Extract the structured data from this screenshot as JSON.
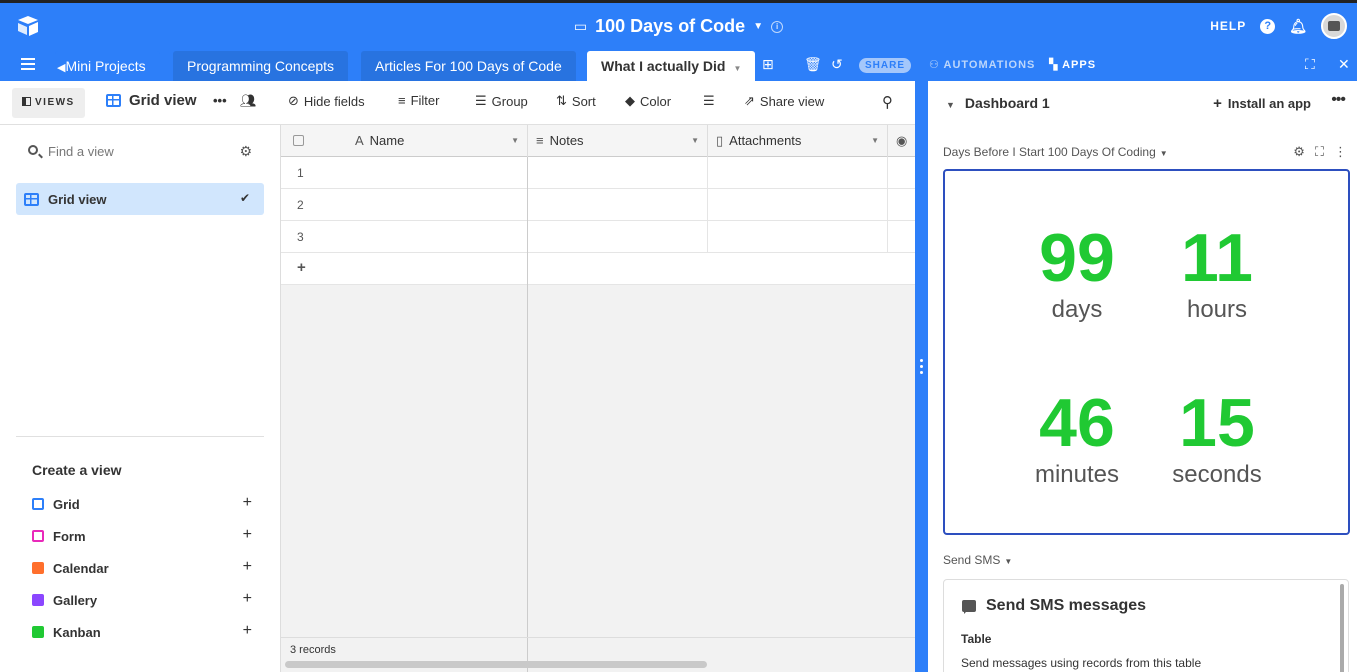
{
  "header": {
    "base_title": "100 Days of Code",
    "help_label": "HELP"
  },
  "tabs": [
    {
      "label": "Mini Projects"
    },
    {
      "label": "Programming Concepts"
    },
    {
      "label": "Articles For 100 Days of Code"
    },
    {
      "label": "What I actually Did"
    }
  ],
  "tabbar": {
    "share_label": "SHARE",
    "automations_label": "AUTOMATIONS",
    "apps_label": "APPS"
  },
  "toolbar": {
    "views_label": "VIEWS",
    "view_name": "Grid view",
    "hide_fields": "Hide fields",
    "filter": "Filter",
    "group": "Group",
    "sort": "Sort",
    "color": "Color",
    "share_view": "Share view"
  },
  "sidebar": {
    "find_placeholder": "Find a view",
    "active_view": "Grid view",
    "create_title": "Create a view",
    "create_items": [
      {
        "label": "Grid",
        "color": "#2d7ff9"
      },
      {
        "label": "Form",
        "color": "#e929ba"
      },
      {
        "label": "Calendar",
        "color": "#ff6f2c"
      },
      {
        "label": "Gallery",
        "color": "#8b46ff"
      },
      {
        "label": "Kanban",
        "color": "#20c933"
      }
    ]
  },
  "grid": {
    "columns": [
      {
        "label": "Name"
      },
      {
        "label": "Notes"
      },
      {
        "label": "Attachments"
      }
    ],
    "rows": [
      "1",
      "2",
      "3"
    ],
    "add_row": "+",
    "record_count": "3 records"
  },
  "dashboard": {
    "title": "Dashboard 1",
    "install_label": "Install an app",
    "countdown_app_label": "Days Before I Start 100 Days Of Coding",
    "countdown": {
      "days": "99",
      "days_label": "days",
      "hours": "11",
      "hours_label": "hours",
      "minutes": "46",
      "minutes_label": "minutes",
      "seconds": "15",
      "seconds_label": "seconds"
    },
    "sms_app_label": "Send SMS",
    "sms_title": "Send SMS messages",
    "sms_table_label": "Table",
    "sms_desc": "Send messages using records from this table"
  },
  "colors": {
    "brand_blue": "#2d7ff9",
    "countdown_green": "#20c933"
  }
}
